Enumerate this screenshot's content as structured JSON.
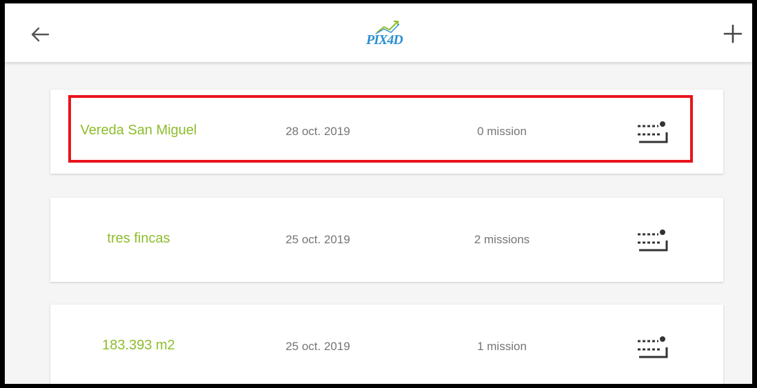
{
  "app": {
    "logo_text": "PIX4D",
    "brand_color": "#2d8fcf",
    "accent_green": "#8dbd2c",
    "highlight_color": "#e8141b"
  },
  "header": {
    "back_icon": "arrow-left-icon",
    "add_icon": "plus-icon"
  },
  "projects": [
    {
      "name": "Vereda San Miguel",
      "date": "28 oct. 2019",
      "missions": "0 mission",
      "icon": "flight-plan-icon"
    },
    {
      "name": "tres fincas",
      "date": "25 oct. 2019",
      "missions": "2 missions",
      "icon": "flight-plan-icon"
    },
    {
      "name": "183.393 m2",
      "date": "25 oct. 2019",
      "missions": "1 mission",
      "icon": "flight-plan-icon"
    }
  ]
}
